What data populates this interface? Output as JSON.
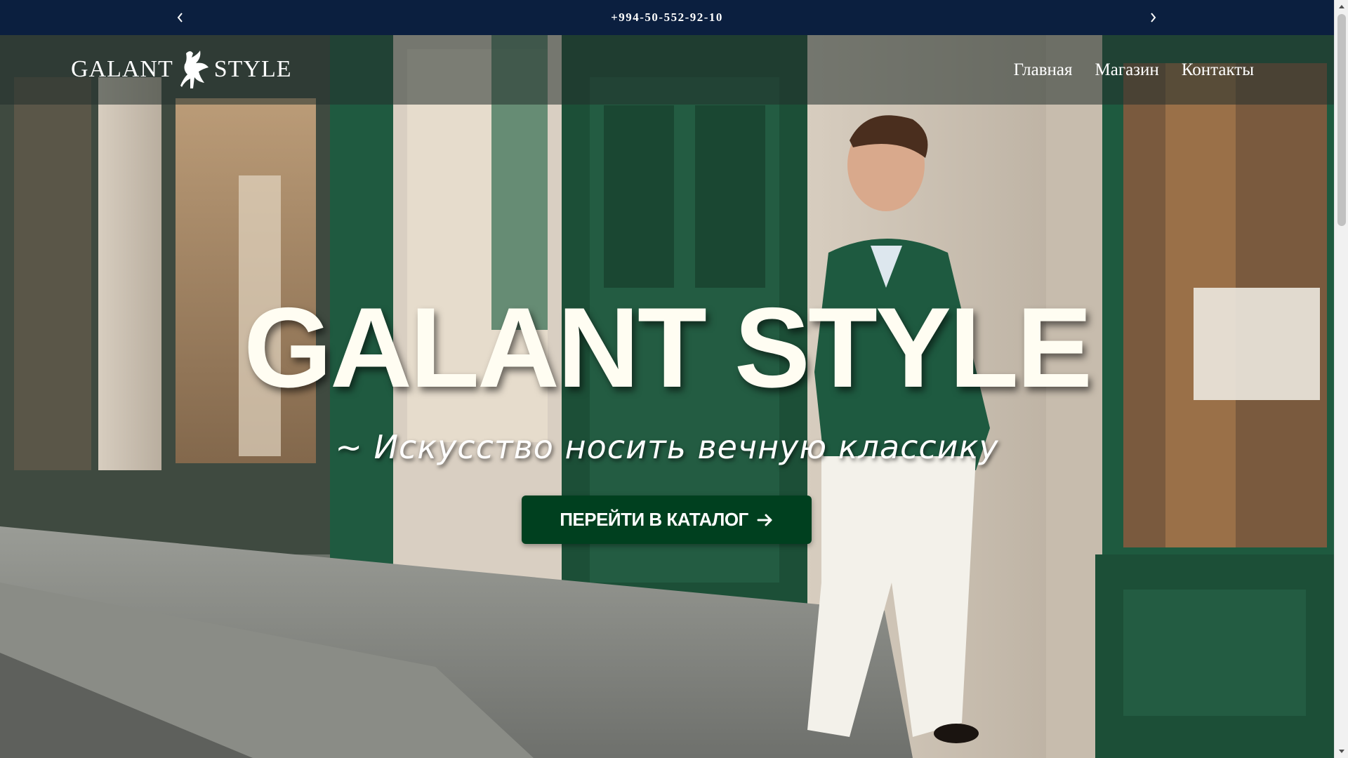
{
  "topbar": {
    "phone": "+994-50-552-92-10",
    "prev_icon": "chevron-left-icon",
    "next_icon": "chevron-right-icon"
  },
  "header": {
    "logo_left": "GALANT",
    "logo_right": "STYLE",
    "logo_icon": "griffin-icon",
    "nav": [
      "Главная",
      "Магазин",
      "Контакты"
    ]
  },
  "hero": {
    "title": "GALANT STYLE",
    "subtitle": "~ Искусство носить вечную классику",
    "cta_label": "ПЕРЕЙТИ В КАТАЛОГ",
    "cta_icon": "arrow-right-icon"
  },
  "colors": {
    "topbar_bg": "#0b1f3f",
    "cta_bg": "#00401f",
    "title_color": "#fffdf2"
  }
}
